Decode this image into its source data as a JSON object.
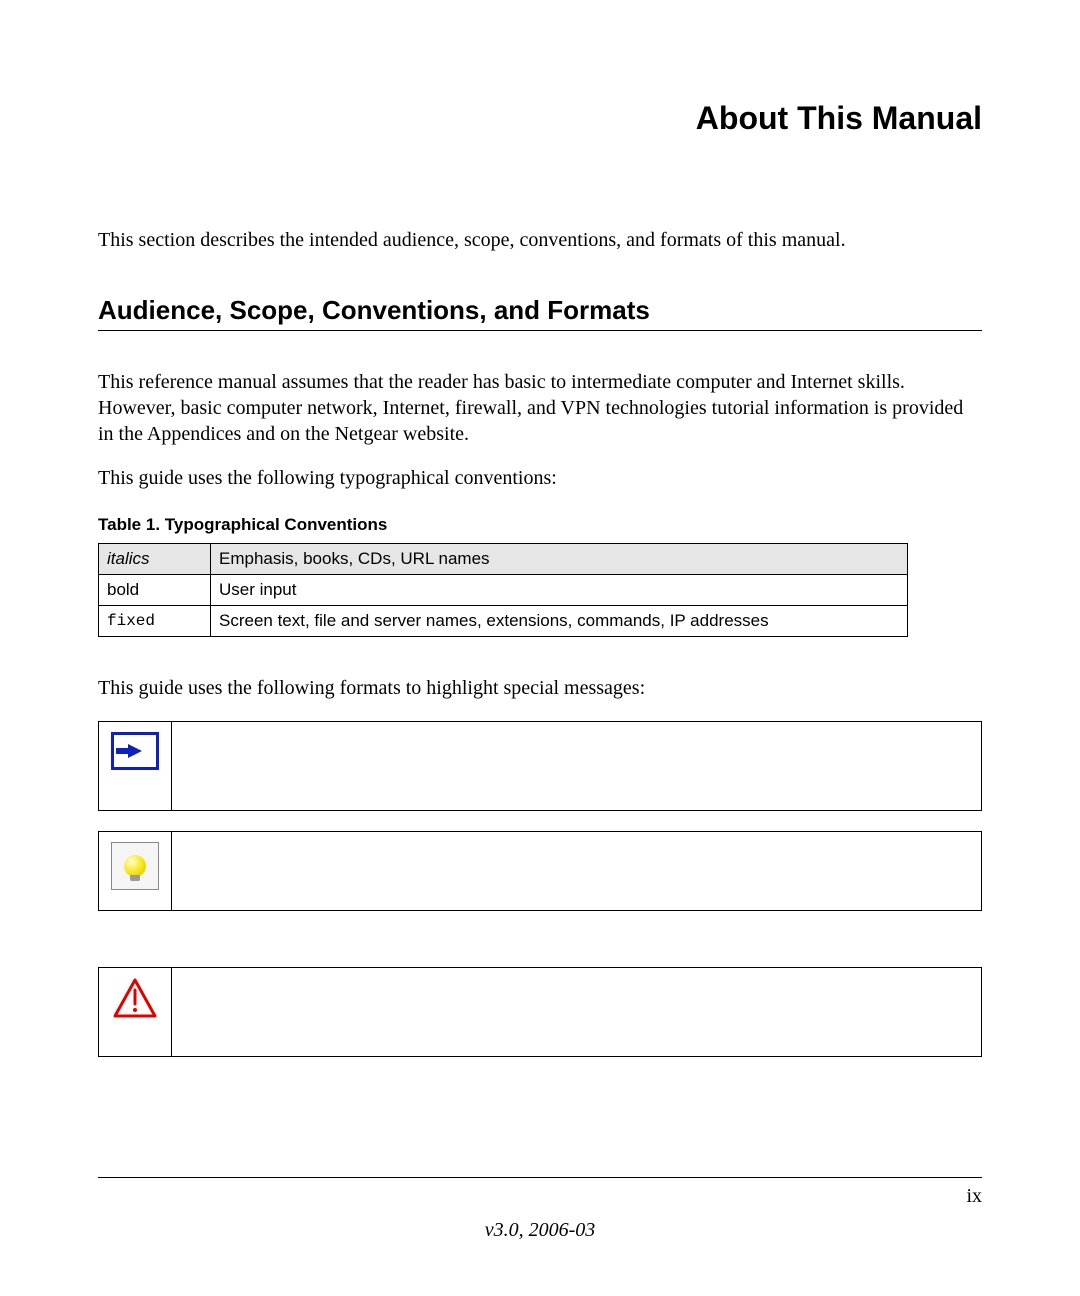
{
  "title": "About This Manual",
  "intro": "This section describes the intended audience, scope, conventions, and formats of this manual.",
  "section_heading": "Audience, Scope, Conventions, and Formats",
  "para1": "This reference manual assumes that the reader has basic to intermediate computer and Internet skills. However, basic computer network, Internet, firewall, and VPN technologies tutorial information is provided in the Appendices and on the Netgear website.",
  "para2": "This guide uses the following typographical conventions:",
  "table_caption": "Table  1. Typographical Conventions",
  "table": {
    "row1": {
      "c1": "italics",
      "c2": "Emphasis, books, CDs, URL names"
    },
    "row2": {
      "c1": "bold",
      "c2": "User input"
    },
    "row3": {
      "c1": "fixed",
      "c2": "Screen text, file and server names, extensions, commands, IP addresses"
    }
  },
  "para3": "This guide uses the following formats to highlight special messages:",
  "footer": {
    "page_number": "ix",
    "version": "v3.0, 2006-03"
  }
}
